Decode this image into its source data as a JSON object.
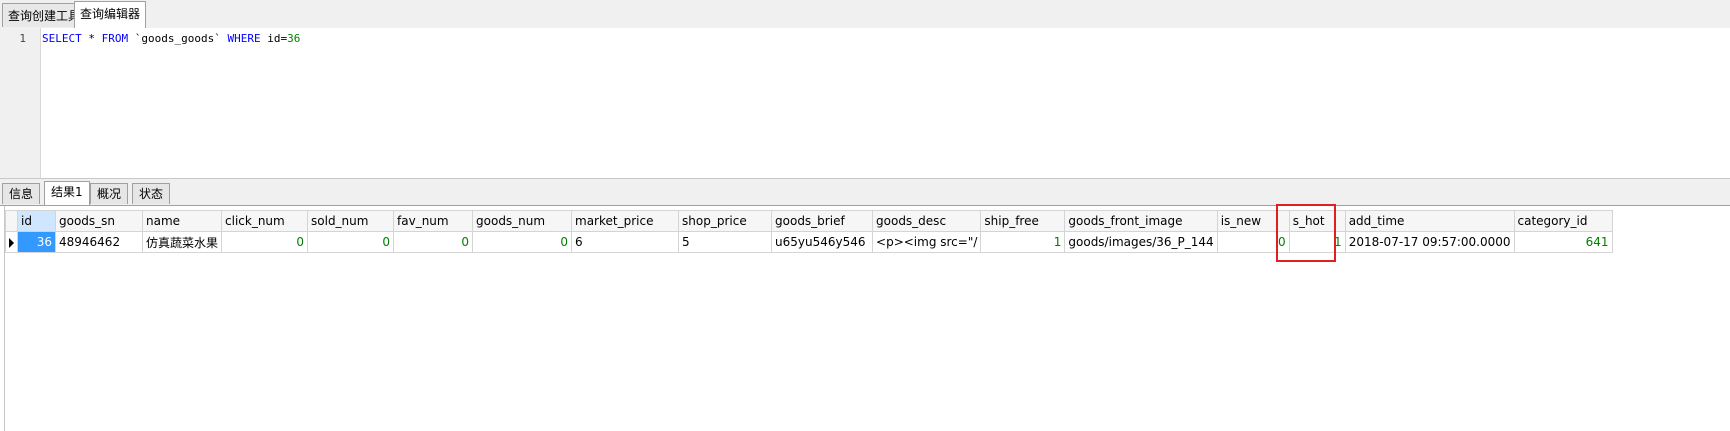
{
  "top_tabs": [
    "查询创建工具",
    "查询编辑器"
  ],
  "editor": {
    "line_number": "1",
    "sql": {
      "select": "SELECT",
      "star": " * ",
      "from": "FROM",
      "table": " `goods_goods` ",
      "where": "WHERE",
      "cond_field": " id=",
      "cond_value": "36"
    }
  },
  "result_tabs": [
    "信息",
    "结果1",
    "概况",
    "状态"
  ],
  "grid": {
    "columns": [
      "id",
      "goods_sn",
      "name",
      "click_num",
      "sold_num",
      "fav_num",
      "goods_num",
      "market_price",
      "shop_price",
      "goods_brief",
      "goods_desc",
      "ship_free",
      "goods_front_image",
      "is_new",
      "s_hot",
      "add_time",
      "category_id"
    ],
    "rows": [
      [
        "36",
        "48946462",
        "仿真蔬菜水果",
        "0",
        "0",
        "0",
        "0",
        "6",
        "5",
        "u65yu546y546",
        "<p><img src=\"/",
        "1",
        "goods/images/36_P_144",
        "0",
        "1",
        "2018-07-17 09:57:00.0000",
        "641"
      ]
    ]
  },
  "colors": {
    "highlight_box": "#e02020",
    "selected_cell": "#3399ff",
    "sql_keyword": "#0000ff",
    "sql_number": "#008000"
  }
}
